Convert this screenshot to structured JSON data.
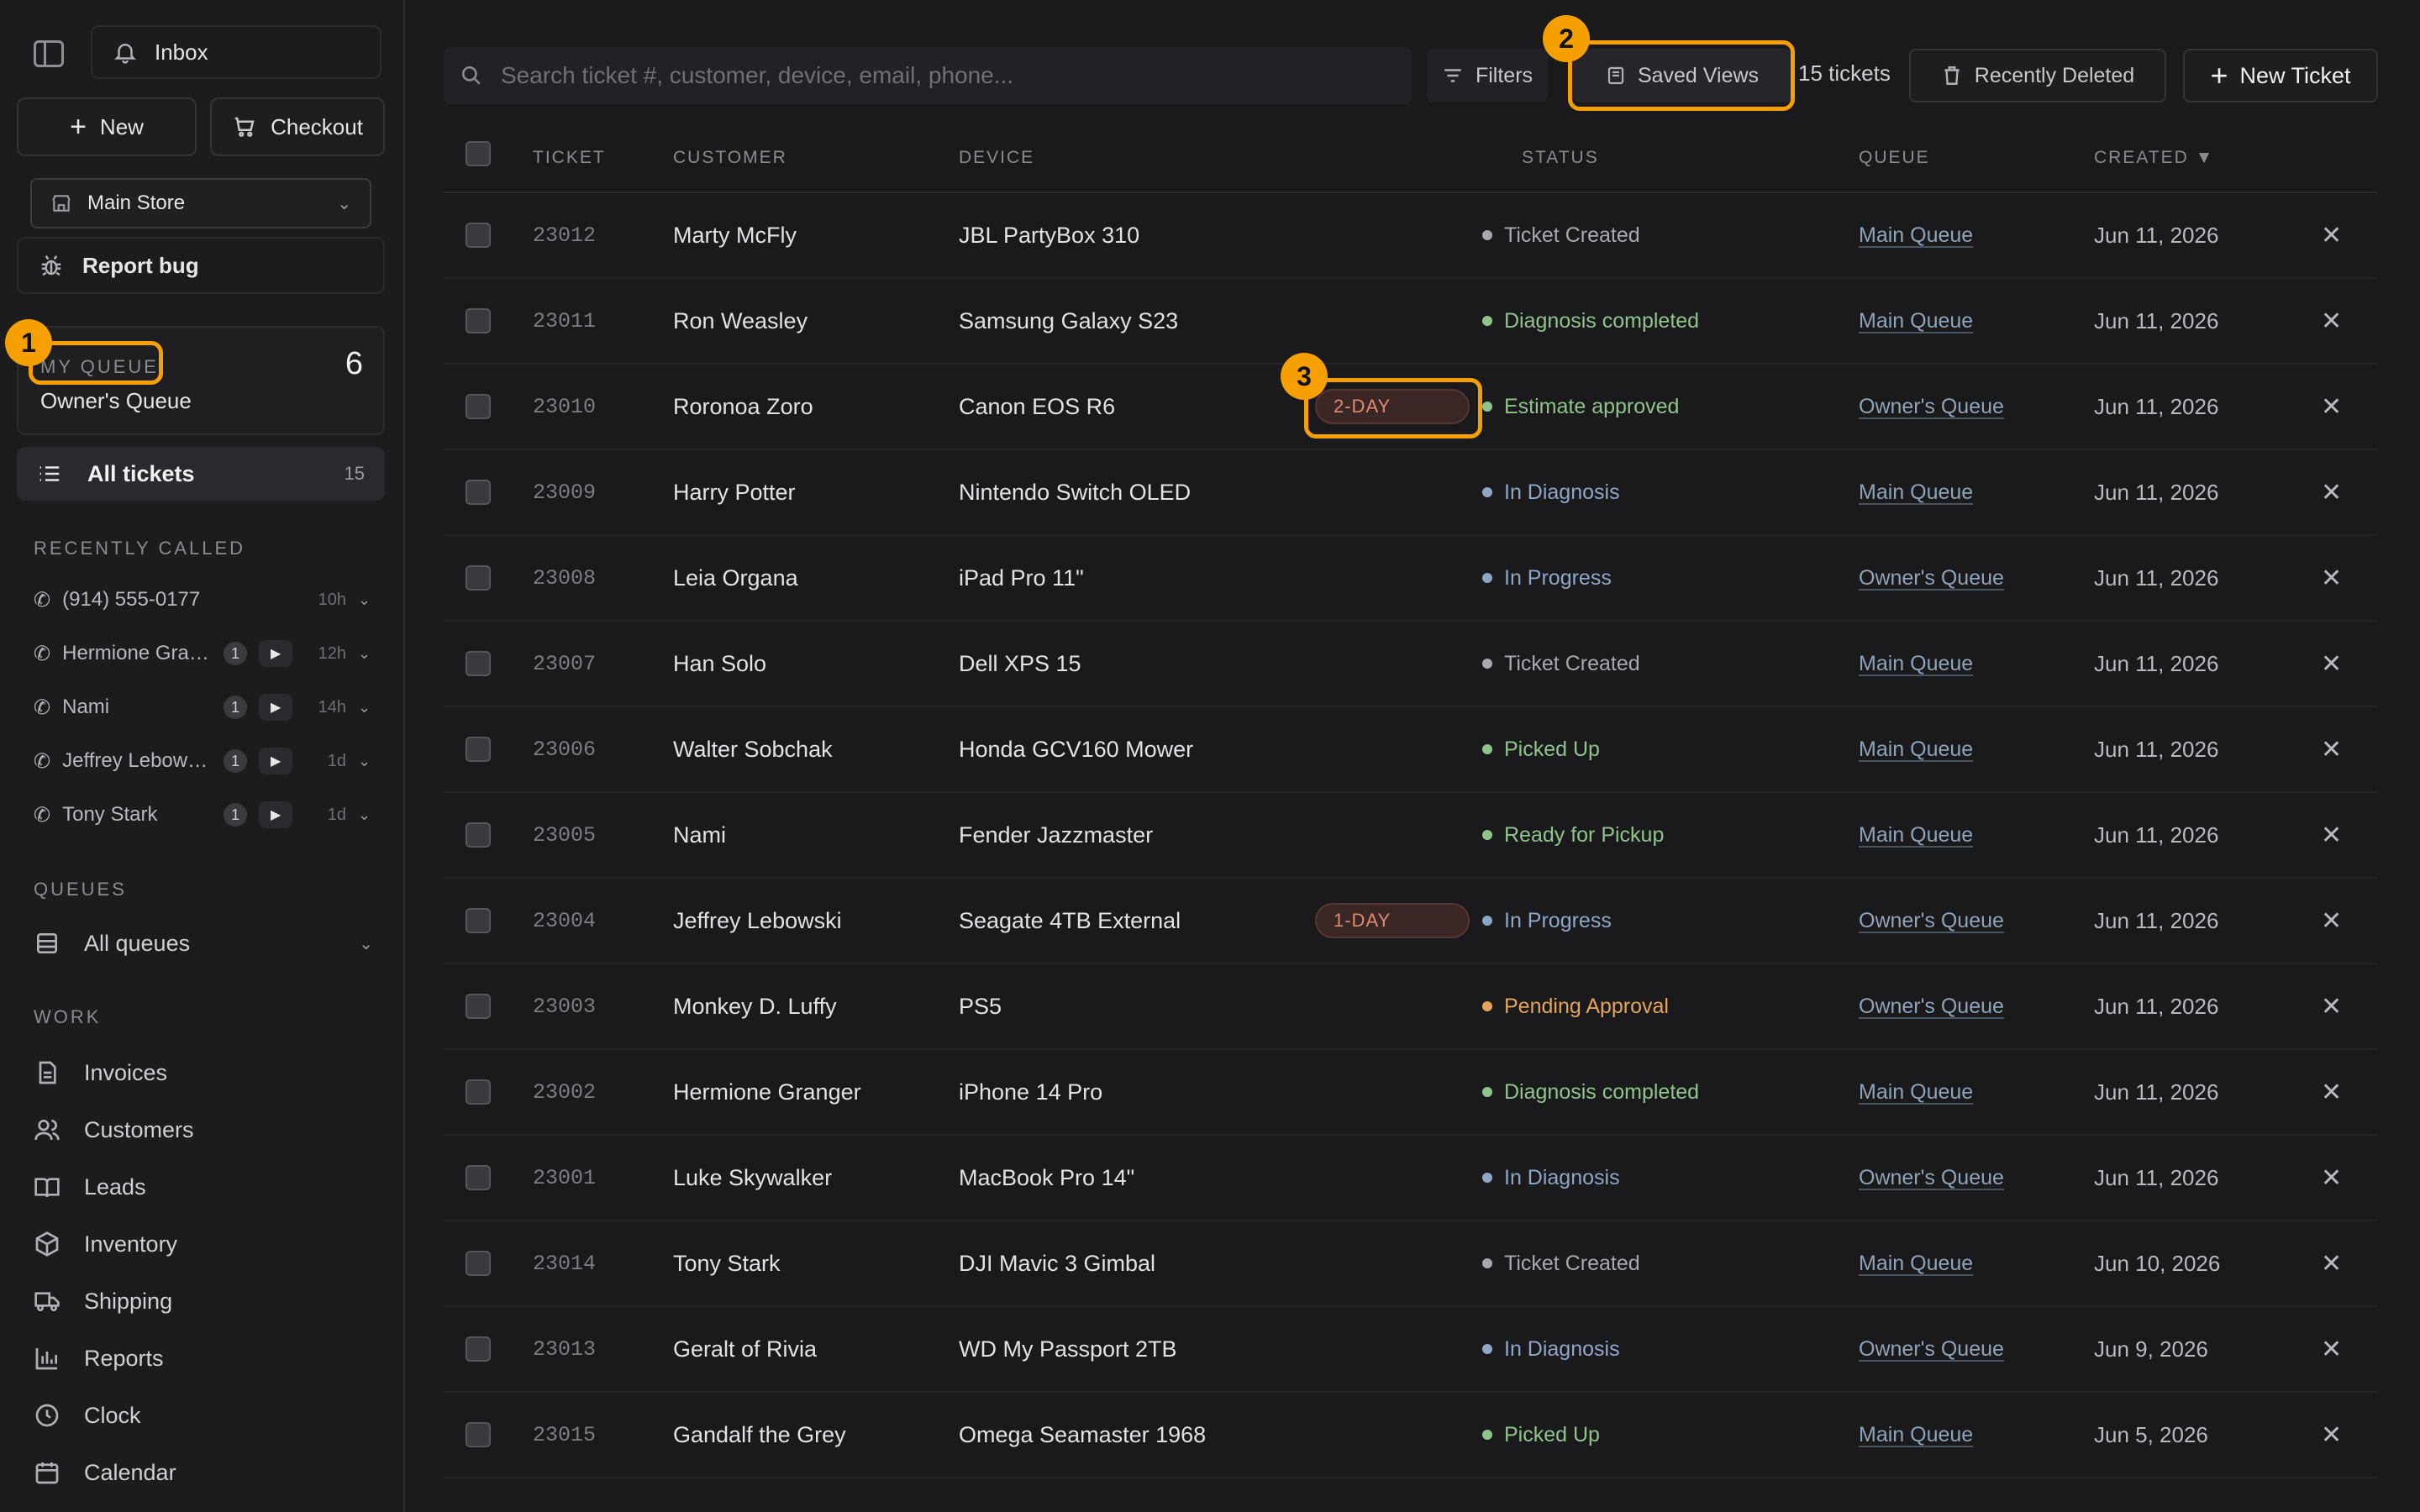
{
  "sidebar": {
    "inbox_label": "Inbox",
    "new_label": "New",
    "checkout_label": "Checkout",
    "store": "Main Store",
    "report_bug_label": "Report bug",
    "my_queue": {
      "label": "MY QUEUE",
      "count": "6",
      "name": "Owner's Queue"
    },
    "all_tickets": {
      "label": "All tickets",
      "count": "15"
    },
    "recently_called_heading": "RECENTLY CALLED",
    "recent_calls": [
      {
        "name": "(914) 555-0177",
        "badge": "",
        "ago": "10h"
      },
      {
        "name": "Hermione Granger",
        "badge": "1",
        "ago": "12h"
      },
      {
        "name": "Nami",
        "badge": "1",
        "ago": "14h"
      },
      {
        "name": "Jeffrey Lebowski",
        "badge": "1",
        "ago": "1d"
      },
      {
        "name": "Tony Stark",
        "badge": "1",
        "ago": "1d"
      }
    ],
    "queues_heading": "QUEUES",
    "all_queues_label": "All queues",
    "work_heading": "WORK",
    "work_items": [
      "Invoices",
      "Customers",
      "Leads",
      "Inventory",
      "Shipping",
      "Reports",
      "Clock",
      "Calendar"
    ]
  },
  "toolbar": {
    "search_placeholder": "Search ticket #, customer, device, email, phone...",
    "filters_label": "Filters",
    "saved_views_label": "Saved Views",
    "ticket_count": "15 tickets",
    "recently_deleted_label": "Recently Deleted",
    "new_ticket_label": "New Ticket"
  },
  "table": {
    "headers": {
      "ticket": "TICKET",
      "customer": "CUSTOMER",
      "device": "DEVICE",
      "status": "STATUS",
      "queue": "QUEUE",
      "created": "CREATED ▼"
    },
    "rows": [
      {
        "ticket": "23012",
        "customer": "Marty McFly",
        "device": "JBL PartyBox 310",
        "tag": "",
        "status": "Ticket Created",
        "status_kind": "grey",
        "queue": "Main Queue",
        "created": "Jun 11, 2026"
      },
      {
        "ticket": "23011",
        "customer": "Ron Weasley",
        "device": "Samsung Galaxy S23",
        "tag": "",
        "status": "Diagnosis completed",
        "status_kind": "green",
        "queue": "Main Queue",
        "created": "Jun 11, 2026"
      },
      {
        "ticket": "23010",
        "customer": "Roronoa Zoro",
        "device": "Canon EOS R6",
        "tag": "2-DAY",
        "status": "Estimate approved",
        "status_kind": "green",
        "queue": "Owner's Queue",
        "created": "Jun 11, 2026"
      },
      {
        "ticket": "23009",
        "customer": "Harry Potter",
        "device": "Nintendo Switch OLED",
        "tag": "",
        "status": "In Diagnosis",
        "status_kind": "blue",
        "queue": "Main Queue",
        "created": "Jun 11, 2026"
      },
      {
        "ticket": "23008",
        "customer": "Leia Organa",
        "device": "iPad Pro 11\"",
        "tag": "",
        "status": "In Progress",
        "status_kind": "blue",
        "queue": "Owner's Queue",
        "created": "Jun 11, 2026"
      },
      {
        "ticket": "23007",
        "customer": "Han Solo",
        "device": "Dell XPS 15",
        "tag": "",
        "status": "Ticket Created",
        "status_kind": "grey",
        "queue": "Main Queue",
        "created": "Jun 11, 2026"
      },
      {
        "ticket": "23006",
        "customer": "Walter Sobchak",
        "device": "Honda GCV160 Mower",
        "tag": "",
        "status": "Picked Up",
        "status_kind": "green",
        "queue": "Main Queue",
        "created": "Jun 11, 2026"
      },
      {
        "ticket": "23005",
        "customer": "Nami",
        "device": "Fender Jazzmaster",
        "tag": "",
        "status": "Ready for Pickup",
        "status_kind": "green",
        "queue": "Main Queue",
        "created": "Jun 11, 2026"
      },
      {
        "ticket": "23004",
        "customer": "Jeffrey Lebowski",
        "device": "Seagate 4TB External",
        "tag": "1-DAY",
        "status": "In Progress",
        "status_kind": "blue",
        "queue": "Owner's Queue",
        "created": "Jun 11, 2026"
      },
      {
        "ticket": "23003",
        "customer": "Monkey D. Luffy",
        "device": "PS5",
        "tag": "",
        "status": "Pending Approval",
        "status_kind": "orange",
        "queue": "Owner's Queue",
        "created": "Jun 11, 2026"
      },
      {
        "ticket": "23002",
        "customer": "Hermione Granger",
        "device": "iPhone 14 Pro",
        "tag": "",
        "status": "Diagnosis completed",
        "status_kind": "green",
        "queue": "Main Queue",
        "created": "Jun 11, 2026"
      },
      {
        "ticket": "23001",
        "customer": "Luke Skywalker",
        "device": "MacBook Pro 14\"",
        "tag": "",
        "status": "In Diagnosis",
        "status_kind": "blue",
        "queue": "Owner's Queue",
        "created": "Jun 11, 2026"
      },
      {
        "ticket": "23014",
        "customer": "Tony Stark",
        "device": "DJI Mavic 3 Gimbal",
        "tag": "",
        "status": "Ticket Created",
        "status_kind": "grey",
        "queue": "Main Queue",
        "created": "Jun 10, 2026"
      },
      {
        "ticket": "23013",
        "customer": "Geralt of Rivia",
        "device": "WD My Passport 2TB",
        "tag": "",
        "status": "In Diagnosis",
        "status_kind": "blue",
        "queue": "Owner's Queue",
        "created": "Jun 9, 2026"
      },
      {
        "ticket": "23015",
        "customer": "Gandalf the Grey",
        "device": "Omega Seamaster 1968",
        "tag": "",
        "status": "Picked Up",
        "status_kind": "green",
        "queue": "Main Queue",
        "created": "Jun 5, 2026"
      }
    ]
  },
  "status_colors": {
    "grey": "#a8a8ae",
    "green": "#8fc48a",
    "blue": "#8ea7c6",
    "orange": "#e3a55a"
  },
  "annotations": {
    "marker_1": "1",
    "marker_2": "2",
    "marker_3": "3",
    "highlight_color": "#f5a000"
  }
}
